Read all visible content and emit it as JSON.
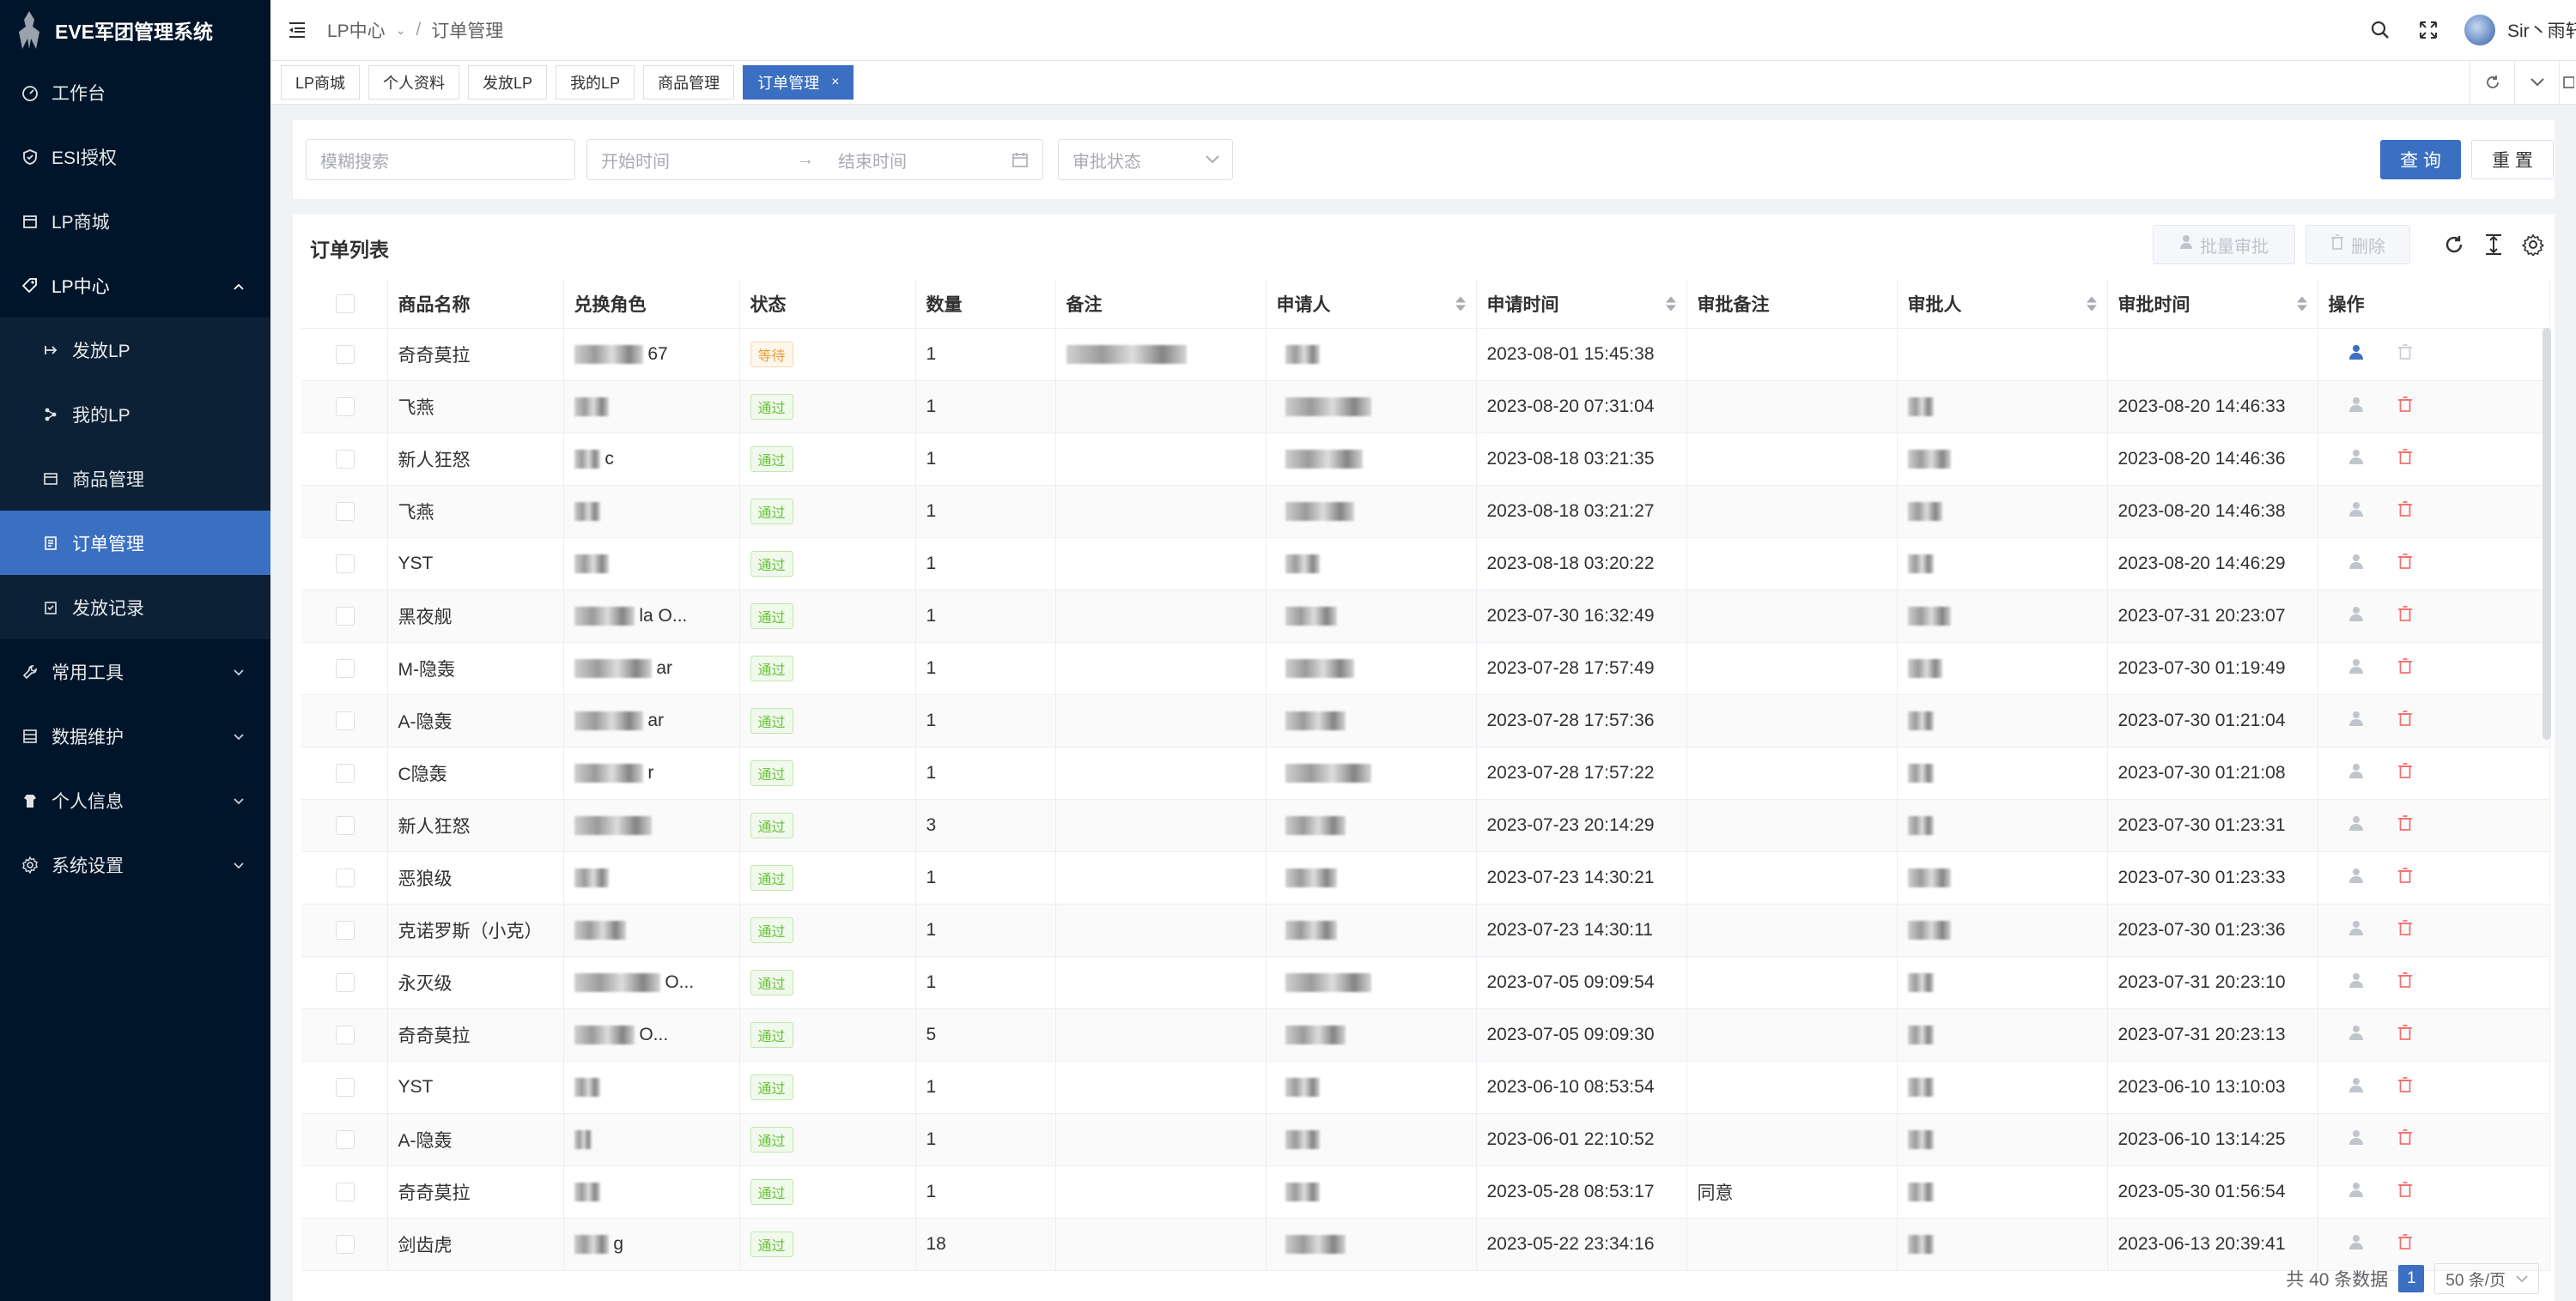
{
  "app": {
    "title": "EVE军团管理系统"
  },
  "sidebar": {
    "items": [
      {
        "label": "工作台",
        "icon": "dashboard-icon"
      },
      {
        "label": "ESI授权",
        "icon": "shield-icon"
      },
      {
        "label": "LP商城",
        "icon": "shop-icon"
      },
      {
        "label": "LP中心",
        "icon": "tag-icon"
      }
    ],
    "sub_items": [
      {
        "label": "发放LP",
        "icon": "send-icon"
      },
      {
        "label": "我的LP",
        "icon": "nodes-icon"
      },
      {
        "label": "商品管理",
        "icon": "goods-icon"
      },
      {
        "label": "订单管理",
        "icon": "order-icon"
      },
      {
        "label": "发放记录",
        "icon": "record-icon"
      }
    ],
    "bottom_items": [
      {
        "label": "常用工具",
        "icon": "tool-icon"
      },
      {
        "label": "数据维护",
        "icon": "data-icon"
      },
      {
        "label": "个人信息",
        "icon": "user-icon"
      },
      {
        "label": "系统设置",
        "icon": "settings-icon"
      }
    ]
  },
  "header": {
    "breadcrumb": [
      "LP中心",
      "订单管理"
    ],
    "username": "Sir丶雨轩"
  },
  "tags": [
    "LP商城",
    "个人资料",
    "发放LP",
    "我的LP",
    "商品管理",
    "订单管理"
  ],
  "search": {
    "keyword_placeholder": "模糊搜索",
    "start_placeholder": "开始时间",
    "end_placeholder": "结束时间",
    "status_placeholder": "审批状态",
    "query_label": "查 询",
    "reset_label": "重 置"
  },
  "table": {
    "title": "订单列表",
    "batch_label": "批量审批",
    "delete_label": "删除",
    "columns": [
      "商品名称",
      "兑换角色",
      "状态",
      "数量",
      "备注",
      "申请人",
      "申请时间",
      "审批备注",
      "审批人",
      "审批时间",
      "操作"
    ],
    "rows": [
      {
        "name": "奇奇莫拉",
        "role": "67",
        "status": "等待",
        "qty": "1",
        "remark": "",
        "apply_time": "2023-08-01 15:45:38",
        "approve_note": "",
        "approve_time": ""
      },
      {
        "name": "飞燕",
        "role": "",
        "status": "通过",
        "qty": "1",
        "remark": "",
        "apply_time": "2023-08-20 07:31:04",
        "approve_note": "",
        "approve_time": "2023-08-20 14:46:33"
      },
      {
        "name": "新人狂怒",
        "role": "c",
        "status": "通过",
        "qty": "1",
        "remark": "",
        "apply_time": "2023-08-18 03:21:35",
        "approve_note": "",
        "approve_time": "2023-08-20 14:46:36"
      },
      {
        "name": "飞燕",
        "role": "",
        "status": "通过",
        "qty": "1",
        "remark": "",
        "apply_time": "2023-08-18 03:21:27",
        "approve_note": "",
        "approve_time": "2023-08-20 14:46:38"
      },
      {
        "name": "YST",
        "role": "",
        "status": "通过",
        "qty": "1",
        "remark": "",
        "apply_time": "2023-08-18 03:20:22",
        "approve_note": "",
        "approve_time": "2023-08-20 14:46:29"
      },
      {
        "name": "黑夜舰",
        "role": "la O...",
        "status": "通过",
        "qty": "1",
        "remark": "",
        "apply_time": "2023-07-30 16:32:49",
        "approve_note": "",
        "approve_time": "2023-07-31 20:23:07"
      },
      {
        "name": "M-隐轰",
        "role": "ar",
        "status": "通过",
        "qty": "1",
        "remark": "",
        "apply_time": "2023-07-28 17:57:49",
        "approve_note": "",
        "approve_time": "2023-07-30 01:19:49"
      },
      {
        "name": "A-隐轰",
        "role": "ar",
        "status": "通过",
        "qty": "1",
        "remark": "",
        "apply_time": "2023-07-28 17:57:36",
        "approve_note": "",
        "approve_time": "2023-07-30 01:21:04"
      },
      {
        "name": "C隐轰",
        "role": "r",
        "status": "通过",
        "qty": "1",
        "remark": "",
        "apply_time": "2023-07-28 17:57:22",
        "approve_note": "",
        "approve_time": "2023-07-30 01:21:08"
      },
      {
        "name": "新人狂怒",
        "role": "",
        "status": "通过",
        "qty": "3",
        "remark": "",
        "apply_time": "2023-07-23 20:14:29",
        "approve_note": "",
        "approve_time": "2023-07-30 01:23:31"
      },
      {
        "name": "恶狼级",
        "role": "",
        "status": "通过",
        "qty": "1",
        "remark": "",
        "apply_time": "2023-07-23 14:30:21",
        "approve_note": "",
        "approve_time": "2023-07-30 01:23:33"
      },
      {
        "name": "克诺罗斯（小克）",
        "role": "",
        "status": "通过",
        "qty": "1",
        "remark": "",
        "apply_time": "2023-07-23 14:30:11",
        "approve_note": "",
        "approve_time": "2023-07-30 01:23:36"
      },
      {
        "name": "永灭级",
        "role": "O...",
        "status": "通过",
        "qty": "1",
        "remark": "",
        "apply_time": "2023-07-05 09:09:54",
        "approve_note": "",
        "approve_time": "2023-07-31 20:23:10"
      },
      {
        "name": "奇奇莫拉",
        "role": "O...",
        "status": "通过",
        "qty": "5",
        "remark": "",
        "apply_time": "2023-07-05 09:09:30",
        "approve_note": "",
        "approve_time": "2023-07-31 20:23:13"
      },
      {
        "name": "YST",
        "role": "",
        "status": "通过",
        "qty": "1",
        "remark": "",
        "apply_time": "2023-06-10 08:53:54",
        "approve_note": "",
        "approve_time": "2023-06-10 13:10:03"
      },
      {
        "name": "A-隐轰",
        "role": "",
        "status": "通过",
        "qty": "1",
        "remark": "",
        "apply_time": "2023-06-01 22:10:52",
        "approve_note": "",
        "approve_time": "2023-06-10 13:14:25"
      },
      {
        "name": "奇奇莫拉",
        "role": "",
        "status": "通过",
        "qty": "1",
        "remark": "",
        "apply_time": "2023-05-28 08:53:17",
        "approve_note": "同意",
        "approve_time": "2023-05-30 01:56:54"
      },
      {
        "name": "剑齿虎",
        "role": "g",
        "status": "通过",
        "qty": "18",
        "remark": "",
        "apply_time": "2023-05-22 23:34:16",
        "approve_note": "",
        "approve_time": "2023-06-13 20:39:41"
      }
    ]
  },
  "pagination": {
    "total_label": "共 40 条数据",
    "current_page": "1",
    "page_size_label": "50 条/页"
  }
}
